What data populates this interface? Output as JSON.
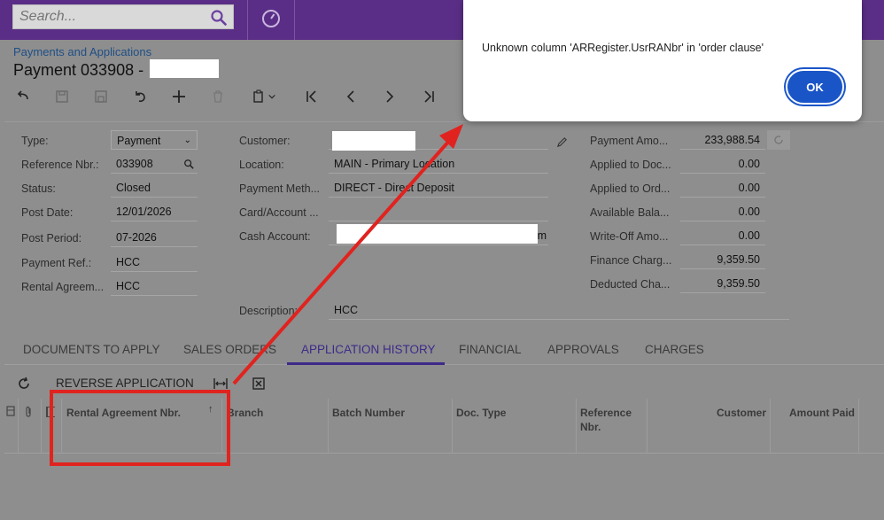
{
  "search": {
    "placeholder": "Search..."
  },
  "breadcrumb": "Payments and Applications",
  "page_title": "Payment 033908 -",
  "form": {
    "type_label": "Type:",
    "type_value": "Payment",
    "ref_label": "Reference Nbr.:",
    "ref_value": "033908",
    "status_label": "Status:",
    "status_value": "Closed",
    "post_date_label": "Post Date:",
    "post_date_value": "12/01/2026",
    "post_period_label": "Post Period:",
    "post_period_value": "07-2026",
    "payment_ref_label": "Payment Ref.:",
    "payment_ref_value": "HCC",
    "rental_label": "Rental Agreem...",
    "rental_value": "HCC",
    "customer_label": "Customer:",
    "location_label": "Location:",
    "location_value": "MAIN - Primary Location",
    "payment_method_label": "Payment Meth...",
    "payment_method_value": "DIRECT - Direct Deposit",
    "card_label": "Card/Account ...",
    "cash_label": "Cash Account:",
    "cash_value_tail": "m",
    "description_label": "Description:",
    "description_value": "HCC",
    "payment_amount_label": "Payment Amo...",
    "payment_amount_value": "233,988.54",
    "applied_doc_label": "Applied to Doc...",
    "applied_doc_value": "0.00",
    "applied_ord_label": "Applied to Ord...",
    "applied_ord_value": "0.00",
    "available_label": "Available Bala...",
    "available_value": "0.00",
    "writeoff_label": "Write-Off Amo...",
    "writeoff_value": "0.00",
    "finance_label": "Finance Charg...",
    "finance_value": "9,359.50",
    "deducted_label": "Deducted Cha...",
    "deducted_value": "9,359.50"
  },
  "tabs": [
    "DOCUMENTS TO APPLY",
    "SALES ORDERS",
    "APPLICATION HISTORY",
    "FINANCIAL",
    "APPROVALS",
    "CHARGES"
  ],
  "grid_toolbar": {
    "reverse_label": "REVERSE APPLICATION"
  },
  "grid_columns": {
    "rental": "Rental Agreement Nbr.",
    "branch": "Branch",
    "batch": "Batch Number",
    "doctype": "Doc. Type",
    "refnbr": "Reference Nbr.",
    "customer": "Customer",
    "amount": "Amount Paid"
  },
  "dialog": {
    "message": "Unknown column 'ARRegister.UsrRANbr' in 'order clause'",
    "ok_label": "OK"
  },
  "colors": {
    "topbar": "#5a2e86",
    "accent": "#3e2a8a",
    "ok_button": "#1a55c8",
    "annotation": "#e0231f"
  }
}
